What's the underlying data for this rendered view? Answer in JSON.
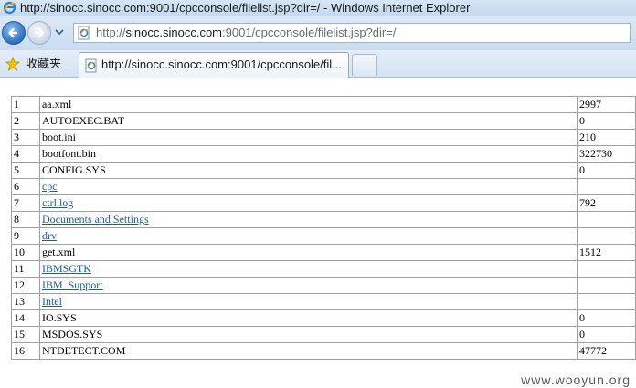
{
  "window": {
    "title": "http://sinocc.sinocc.com:9001/cpcconsole/filelist.jsp?dir=/ - Windows Internet Explorer"
  },
  "address": {
    "prefix": "http://",
    "host": "sinocc.sinocc.com",
    "rest": ":9001/cpcconsole/filelist.jsp?dir=/"
  },
  "toolbar": {
    "favorites_label": "收藏夹"
  },
  "tabs": [
    {
      "label": "http://sinocc.sinocc.com:9001/cpcconsole/fil..."
    }
  ],
  "files": [
    {
      "idx": "1",
      "name": "aa.xml",
      "size": "2997",
      "link": false
    },
    {
      "idx": "2",
      "name": "AUTOEXEC.BAT",
      "size": "0",
      "link": false
    },
    {
      "idx": "3",
      "name": "boot.ini",
      "size": "210",
      "link": false
    },
    {
      "idx": "4",
      "name": "bootfont.bin",
      "size": "322730",
      "link": false
    },
    {
      "idx": "5",
      "name": "CONFIG.SYS",
      "size": "0",
      "link": false
    },
    {
      "idx": "6",
      "name": "cpc",
      "size": "",
      "link": true
    },
    {
      "idx": "7",
      "name": "ctrl.log",
      "size": "792",
      "link": true
    },
    {
      "idx": "8",
      "name": "Documents and Settings",
      "size": "",
      "link": true
    },
    {
      "idx": "9",
      "name": "drv",
      "size": "",
      "link": true
    },
    {
      "idx": "10",
      "name": "get.xml",
      "size": "1512",
      "link": false
    },
    {
      "idx": "11",
      "name": "IBMSGTK",
      "size": "",
      "link": true
    },
    {
      "idx": "12",
      "name": "IBM_Support",
      "size": "",
      "link": true
    },
    {
      "idx": "13",
      "name": "Intel",
      "size": "",
      "link": true
    },
    {
      "idx": "14",
      "name": "IO.SYS",
      "size": "0",
      "link": false
    },
    {
      "idx": "15",
      "name": "MSDOS.SYS",
      "size": "0",
      "link": false
    },
    {
      "idx": "16",
      "name": "NTDETECT.COM",
      "size": "47772",
      "link": false
    }
  ],
  "watermark": "www.wooyun.org",
  "colors": {
    "link": "#1f5aa8",
    "chrome": "#c9dcf0",
    "border": "#a0a0a0"
  }
}
